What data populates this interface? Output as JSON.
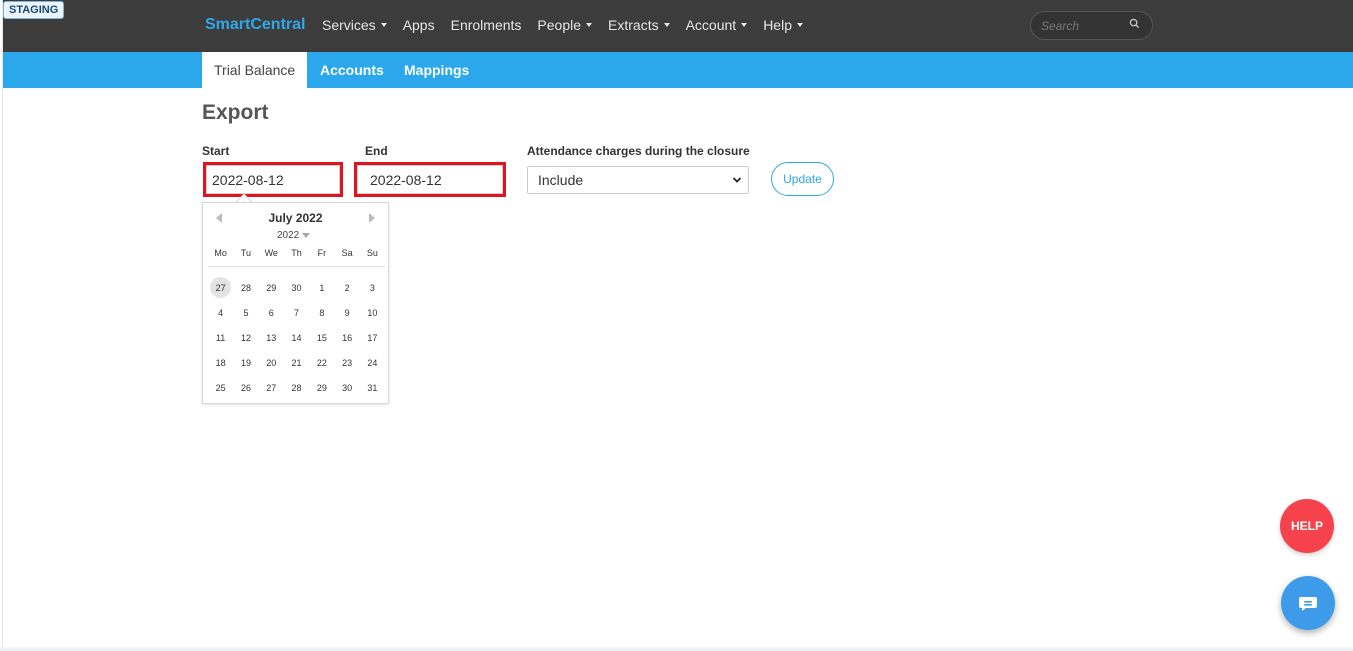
{
  "environment_badge": "STAGING",
  "brand": "SmartCentral",
  "nav": [
    {
      "label": "Services",
      "dropdown": true
    },
    {
      "label": "Apps",
      "dropdown": false
    },
    {
      "label": "Enrolments",
      "dropdown": false
    },
    {
      "label": "People",
      "dropdown": true
    },
    {
      "label": "Extracts",
      "dropdown": true
    },
    {
      "label": "Account",
      "dropdown": true
    },
    {
      "label": "Help",
      "dropdown": true
    }
  ],
  "search": {
    "placeholder": "Search",
    "icon": "search-icon"
  },
  "subnav": {
    "tabs": [
      {
        "label": "Trial Balance",
        "active": true
      },
      {
        "label": "Accounts",
        "active": false
      },
      {
        "label": "Mappings",
        "active": false
      }
    ]
  },
  "page": {
    "title": "Export",
    "start_label": "Start",
    "start_value": "2022-08-12",
    "end_label": "End",
    "end_value": "2022-08-12",
    "closure_label": "Attendance charges during the closure",
    "closure_value": "Include",
    "update_label": "Update"
  },
  "calendar": {
    "month_label": "July 2022",
    "year_label": "2022",
    "weekdays": [
      "Mo",
      "Tu",
      "We",
      "Th",
      "Fr",
      "Sa",
      "Su"
    ],
    "days": [
      "27",
      "28",
      "29",
      "30",
      "1",
      "2",
      "3",
      "4",
      "5",
      "6",
      "7",
      "8",
      "9",
      "10",
      "11",
      "12",
      "13",
      "14",
      "15",
      "16",
      "17",
      "18",
      "19",
      "20",
      "21",
      "22",
      "23",
      "24",
      "25",
      "26",
      "27",
      "28",
      "29",
      "30",
      "31"
    ],
    "highlighted_index": 0
  },
  "help_button": "HELP",
  "chat_button": {
    "icon": "chat-icon"
  },
  "colors": {
    "brand": "#2fa8ea",
    "subbar": "#2ba8ec",
    "topbar": "#3c3c3c",
    "highlight_border": "#e0141e",
    "help": "#f5424c",
    "chat": "#3d9be9"
  }
}
